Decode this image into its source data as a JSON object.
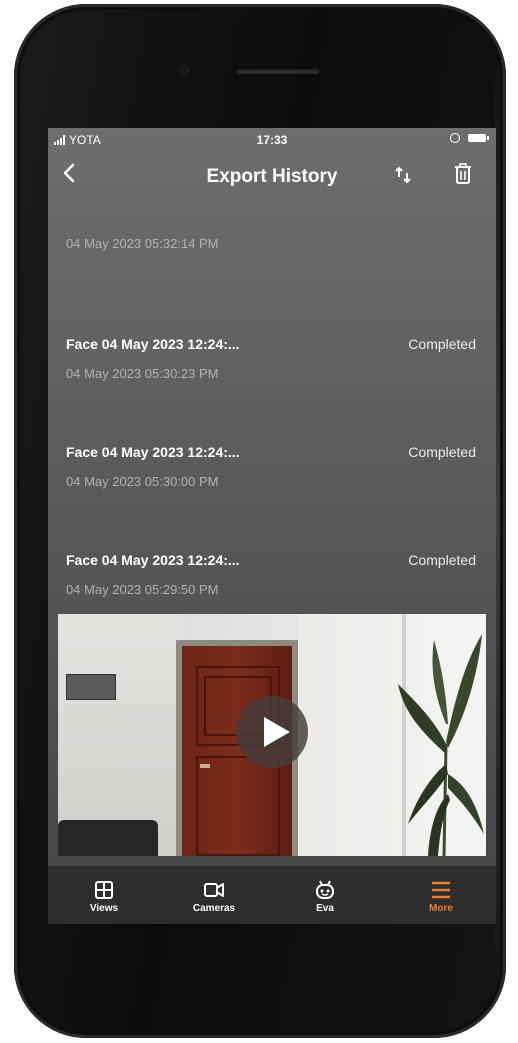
{
  "status_bar": {
    "carrier": "YOTA",
    "time": "17:33"
  },
  "header": {
    "title": "Export History",
    "back_icon": "chevron-left-icon",
    "sort_icon": "sort-arrows-icon",
    "delete_icon": "trash-icon"
  },
  "exports": [
    {
      "title": "",
      "status": "",
      "timestamp": "04 May 2023 05:32:14 PM"
    },
    {
      "title": "Face 04 May 2023 12:24:...",
      "status": "Completed",
      "timestamp": "04 May 2023 05:30:23 PM"
    },
    {
      "title": "Face 04 May 2023 12:24:...",
      "status": "Completed",
      "timestamp": "04 May 2023 05:30:00 PM"
    },
    {
      "title": "Face 04 May 2023 12:24:...",
      "status": "Completed",
      "timestamp": "04 May 2023 05:29:50 PM"
    }
  ],
  "tabs": [
    {
      "label": "Views",
      "icon": "grid-icon",
      "active": false
    },
    {
      "label": "Cameras",
      "icon": "camera-icon",
      "active": false
    },
    {
      "label": "Eva",
      "icon": "robot-icon",
      "active": false
    },
    {
      "label": "More",
      "icon": "menu-icon",
      "active": true
    }
  ],
  "colors": {
    "accent": "#f07a2a",
    "tab_bar": "#2e2e30",
    "screen_top": "#6e6e70",
    "screen_bottom": "#444446"
  }
}
